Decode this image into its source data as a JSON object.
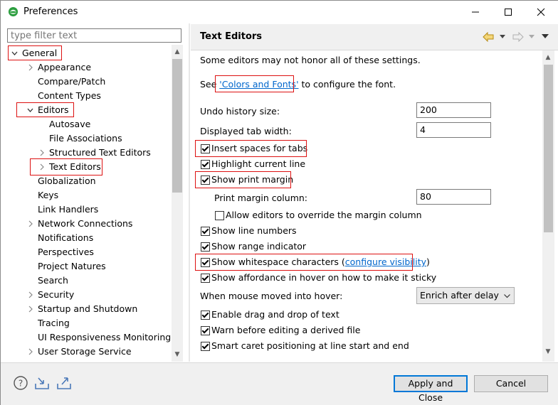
{
  "window": {
    "title": "Preferences",
    "icons": {
      "app": "eclipse-icon",
      "minimize": "minimize-icon",
      "maximize": "maximize-icon",
      "close": "close-icon"
    }
  },
  "filter": {
    "placeholder": "type filter text"
  },
  "tree": [
    {
      "id": "general",
      "label": "General",
      "twisty": "expanded",
      "level": 0
    },
    {
      "id": "appearance",
      "label": "Appearance",
      "twisty": "collapsed",
      "level": 1
    },
    {
      "id": "compare-patch",
      "label": "Compare/Patch",
      "twisty": "none",
      "level": 1
    },
    {
      "id": "content-types",
      "label": "Content Types",
      "twisty": "none",
      "level": 1
    },
    {
      "id": "editors",
      "label": "Editors",
      "twisty": "expanded",
      "level": 1
    },
    {
      "id": "autosave",
      "label": "Autosave",
      "twisty": "none",
      "level": 2
    },
    {
      "id": "file-associations",
      "label": "File Associations",
      "twisty": "none",
      "level": 2
    },
    {
      "id": "structured-text-editors",
      "label": "Structured Text Editors",
      "twisty": "collapsed",
      "level": 2
    },
    {
      "id": "text-editors",
      "label": "Text Editors",
      "twisty": "collapsed",
      "level": 2,
      "selected": true
    },
    {
      "id": "globalization",
      "label": "Globalization",
      "twisty": "none",
      "level": 1
    },
    {
      "id": "keys",
      "label": "Keys",
      "twisty": "none",
      "level": 1
    },
    {
      "id": "link-handlers",
      "label": "Link Handlers",
      "twisty": "none",
      "level": 1
    },
    {
      "id": "network-connections",
      "label": "Network Connections",
      "twisty": "collapsed",
      "level": 1
    },
    {
      "id": "notifications",
      "label": "Notifications",
      "twisty": "none",
      "level": 1
    },
    {
      "id": "perspectives",
      "label": "Perspectives",
      "twisty": "none",
      "level": 1
    },
    {
      "id": "project-natures",
      "label": "Project Natures",
      "twisty": "none",
      "level": 1
    },
    {
      "id": "search",
      "label": "Search",
      "twisty": "none",
      "level": 1
    },
    {
      "id": "security",
      "label": "Security",
      "twisty": "collapsed",
      "level": 1
    },
    {
      "id": "startup-and-shutdown",
      "label": "Startup and Shutdown",
      "twisty": "collapsed",
      "level": 1
    },
    {
      "id": "tracing",
      "label": "Tracing",
      "twisty": "none",
      "level": 1
    },
    {
      "id": "ui-responsiveness-monitoring",
      "label": "UI Responsiveness Monitoring",
      "twisty": "none",
      "level": 1
    },
    {
      "id": "user-storage-service",
      "label": "User Storage Service",
      "twisty": "collapsed",
      "level": 1
    }
  ],
  "page": {
    "title": "Text Editors",
    "nav_icons": {
      "back": "back-arrow-icon",
      "back_menu": "chevron-down-icon",
      "forward": "forward-arrow-icon",
      "forward_menu": "chevron-down-icon",
      "view_menu": "view-menu-icon"
    },
    "intro": "Some editors may not honor all of these settings.",
    "see_prefix": "See ",
    "colors_fonts_link": "'Colors and Fonts'",
    "see_suffix": " to configure the font.",
    "undo_history": {
      "label": "Undo history size:",
      "value": "200"
    },
    "tab_width": {
      "label": "Displayed tab width:",
      "value": "4"
    },
    "insert_spaces": {
      "label": "Insert spaces for tabs",
      "checked": true
    },
    "highlight_line": {
      "label": "Highlight current line",
      "checked": true
    },
    "show_print_margin": {
      "label": "Show print margin",
      "checked": true
    },
    "print_margin_column": {
      "label": "Print margin column:",
      "value": "80"
    },
    "allow_override": {
      "label": "Allow editors to override the margin column",
      "checked": false
    },
    "show_line_numbers": {
      "label": "Show line numbers",
      "checked": true
    },
    "show_range": {
      "label": "Show range indicator",
      "checked": true
    },
    "show_whitespace": {
      "label": "Show whitespace characters (",
      "link": "configure visibility",
      "suffix": ")",
      "checked": true
    },
    "show_affordance": {
      "label": "Show affordance in hover on how to make it sticky",
      "checked": true
    },
    "hover": {
      "label": "When mouse moved into hover:",
      "value": "Enrich after delay"
    },
    "drag_drop": {
      "label": "Enable drag and drop of text",
      "checked": true
    },
    "warn_derived": {
      "label": "Warn before editing a derived file",
      "checked": true
    },
    "smart_caret": {
      "label": "Smart caret positioning at line start and end",
      "checked": true
    }
  },
  "bottom": {
    "icons": {
      "help": "help-icon",
      "import": "import-icon",
      "export": "export-icon"
    },
    "apply_close": "Apply and Close",
    "cancel": "Cancel"
  },
  "colors": {
    "highlight_box": "#dd1111",
    "link": "#0066cc",
    "default_button_border": "#0078d7"
  }
}
